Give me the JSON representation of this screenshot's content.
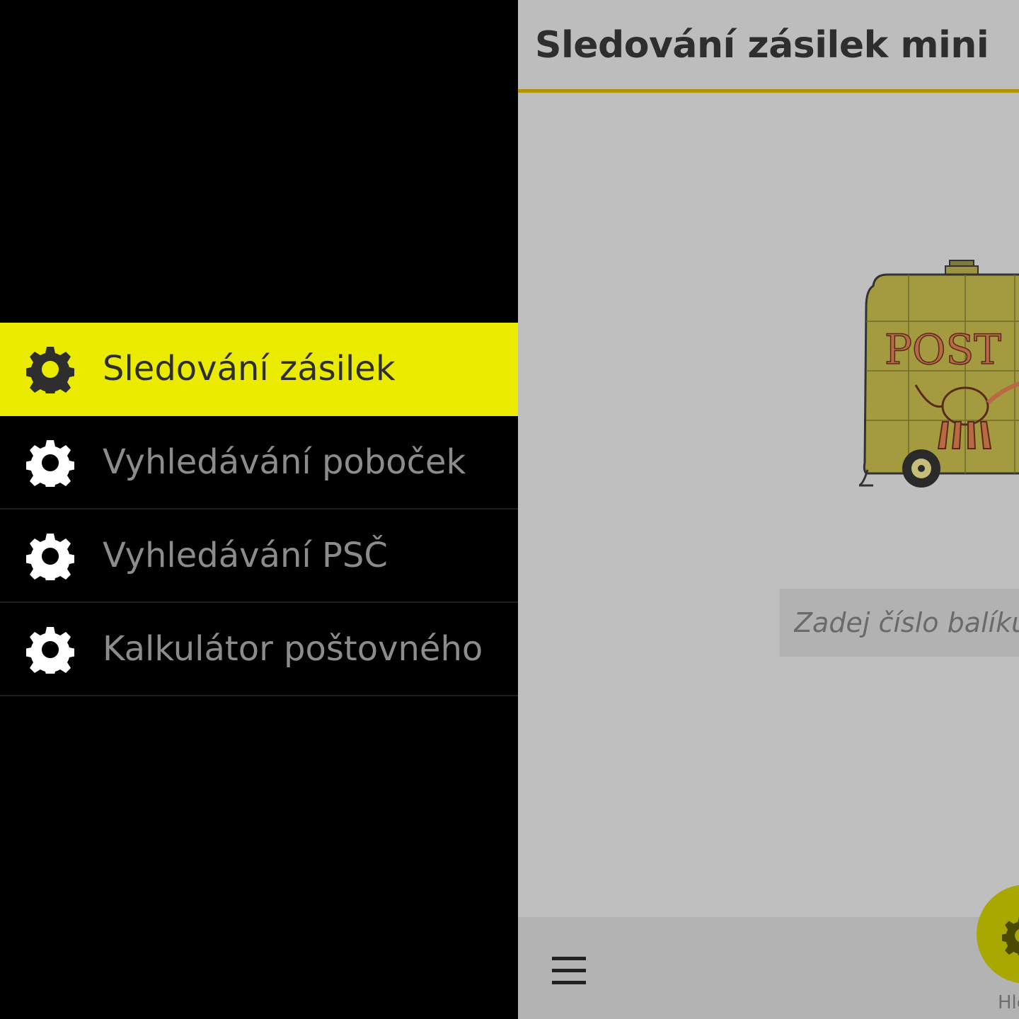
{
  "drawer": {
    "items": [
      {
        "label": "Sledování zásilek",
        "icon": "gear-icon",
        "active": true
      },
      {
        "label": "Vyhledávání poboček",
        "icon": "gear-icon",
        "active": false
      },
      {
        "label": "Vyhledávání PSČ",
        "icon": "gear-icon",
        "active": false
      },
      {
        "label": "Kalkulátor poštovného",
        "icon": "gear-icon",
        "active": false
      }
    ]
  },
  "header": {
    "title": "Sledování zásilek mini"
  },
  "illustration": {
    "text": "POST",
    "icon": "post-truck-illustration"
  },
  "search": {
    "placeholder": "Zadej číslo balíku"
  },
  "bottom": {
    "menu_icon": "hamburger-menu-icon",
    "fab_icon": "gear-icon",
    "fab_label": "Hle"
  },
  "colors": {
    "accent": "#ebeb00",
    "title_underline": "#b09500",
    "fab": "#a8a800"
  }
}
